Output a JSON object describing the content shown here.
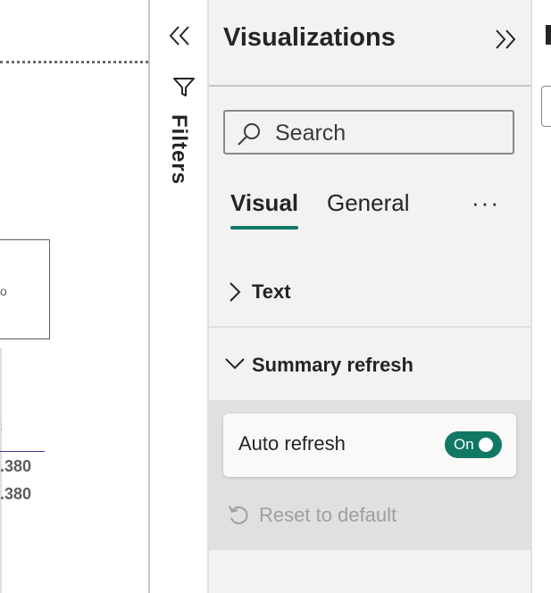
{
  "canvas": {
    "values": [
      ".380",
      ".380"
    ]
  },
  "filters": {
    "label": "Filters",
    "collapse_icon": "double-chevron-left-icon",
    "filter_icon": "funnel-icon"
  },
  "visualizations": {
    "title": "Visualizations",
    "expand_icon": "double-chevron-right-icon",
    "search": {
      "placeholder": "Search",
      "value": ""
    },
    "tabs": [
      {
        "label": "Visual",
        "selected": true
      },
      {
        "label": "General",
        "selected": false
      }
    ],
    "more_label": "···",
    "sections": {
      "text": {
        "label": "Text",
        "expanded": false
      },
      "summary_refresh": {
        "label": "Summary refresh",
        "expanded": true,
        "auto_refresh": {
          "label": "Auto refresh",
          "state": "On"
        },
        "reset_label": "Reset to default"
      }
    }
  },
  "colors": {
    "accent": "#117865",
    "pane_bg": "#f3f2f1",
    "disabled_text": "#a19f9d"
  }
}
